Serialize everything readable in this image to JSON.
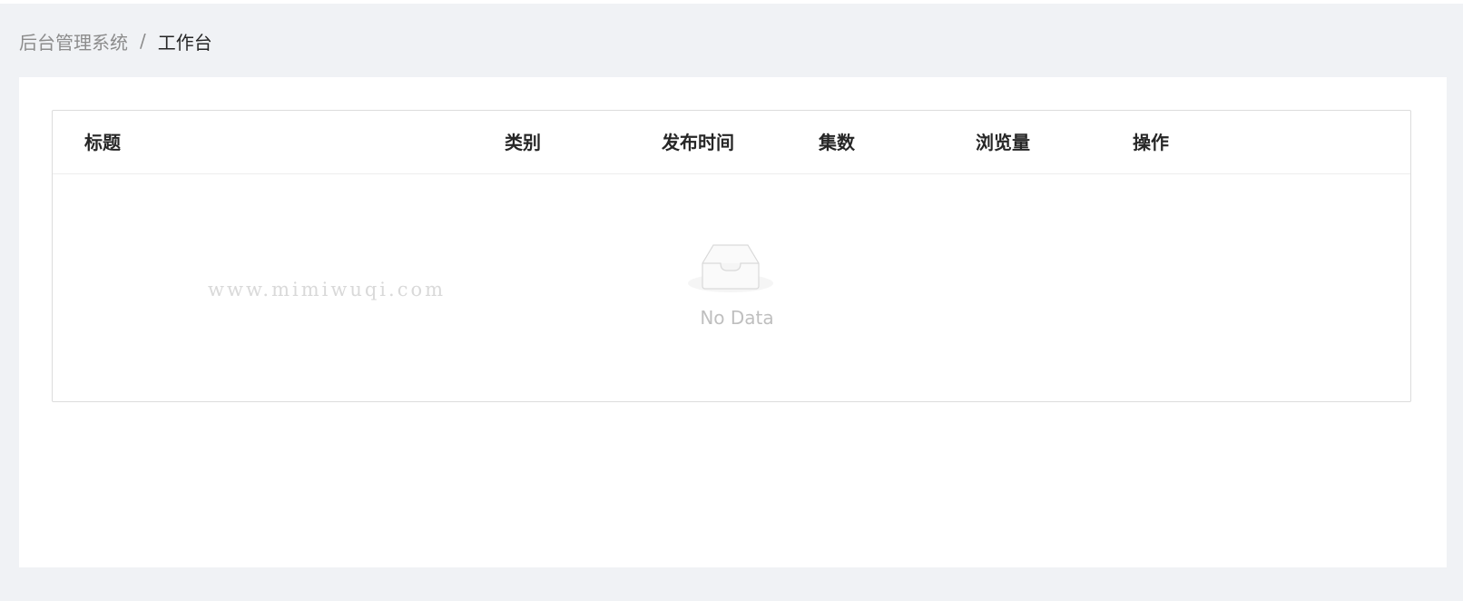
{
  "breadcrumb": {
    "root": "后台管理系统",
    "separator": "/",
    "current": "工作台"
  },
  "table": {
    "columns": [
      "标题",
      "类别",
      "发布时间",
      "集数",
      "浏览量",
      "操作"
    ],
    "rows": [],
    "empty_text": "No Data"
  },
  "watermark": "www.mimiwuqi.com",
  "icons": {
    "empty": "empty-inbox-icon"
  },
  "colors": {
    "page_bg": "#f0f2f5",
    "card_bg": "#ffffff",
    "border": "#dcdcdc",
    "header_text": "#262626",
    "muted_text": "#8c8c8c",
    "empty_text": "#bfbfbf"
  }
}
